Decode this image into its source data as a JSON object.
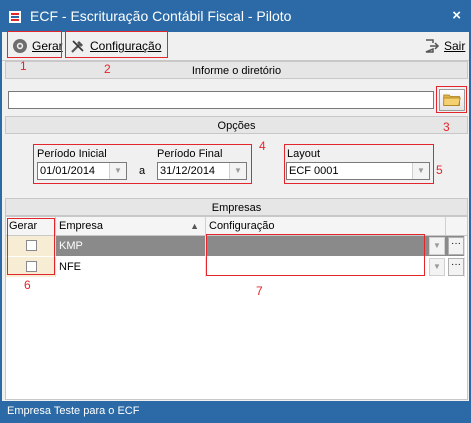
{
  "window": {
    "title": "ECF - Escrituração Contábil Fiscal - Piloto",
    "close_glyph": "×"
  },
  "toolbar": {
    "gerar_label": "Gerar",
    "configuracao_label": "Configuração",
    "sair_label": "Sair"
  },
  "directory": {
    "header": "Informe o diretório",
    "value": ""
  },
  "options": {
    "header": "Opções",
    "periodo_inicial_label": "Período Inicial",
    "periodo_inicial_value": "01/01/2014",
    "a_label": "a",
    "periodo_final_label": "Período Final",
    "periodo_final_value": "31/12/2014",
    "layout_label": "Layout",
    "layout_value": "ECF 0001"
  },
  "empresas": {
    "header": "Empresas",
    "columns": [
      "Gerar",
      "Empresa",
      "Configuração"
    ],
    "rows": [
      {
        "empresa": "KMP",
        "configuracao": "",
        "selected": true
      },
      {
        "empresa": "NFE",
        "configuracao": "",
        "selected": false
      }
    ]
  },
  "annotations": [
    "1",
    "2",
    "3",
    "4",
    "5",
    "6",
    "7"
  ],
  "status": {
    "text": "Empresa Teste para o ECF"
  },
  "colors": {
    "titlebar": "#2b6aa6",
    "annotation_red": "#e3262b",
    "selected_row": "#8a8a8a"
  },
  "icons": {
    "window": "ecf-logo-icon",
    "gerar": "gear-play-icon",
    "configuracao": "tools-icon",
    "sair": "exit-icon",
    "folder": "folder-icon",
    "sort": "sort-triangle-icon"
  }
}
